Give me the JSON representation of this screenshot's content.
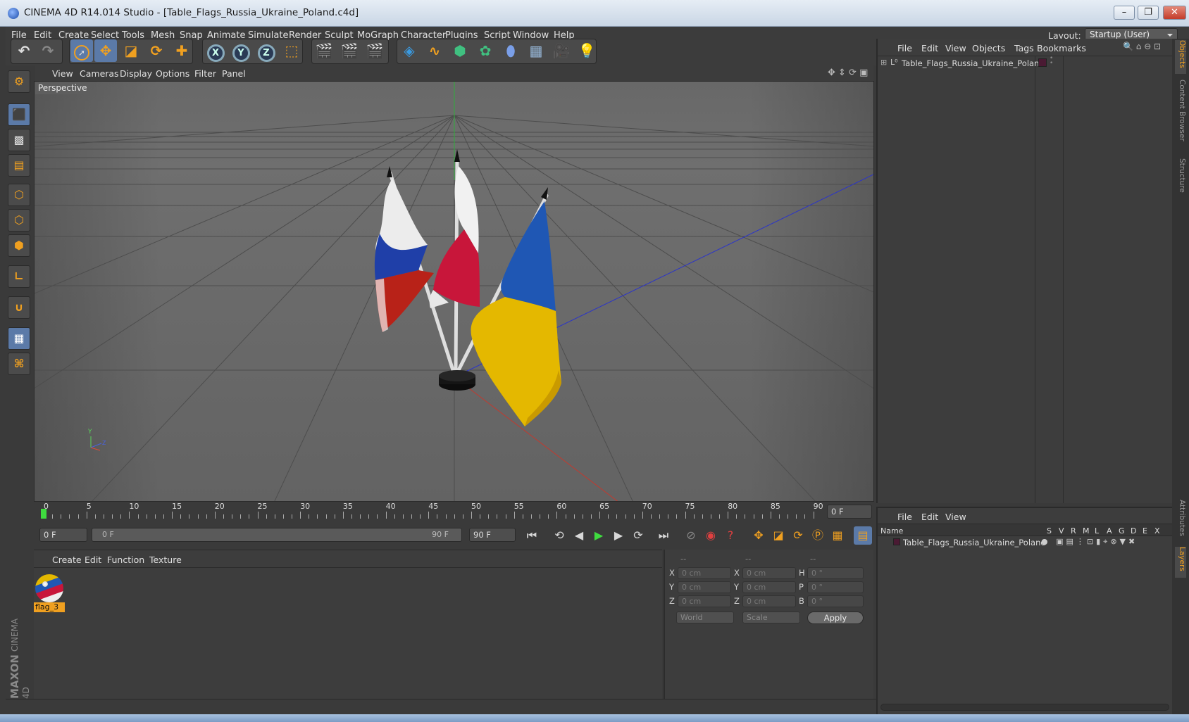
{
  "window": {
    "title": "CINEMA 4D R14.014 Studio - [Table_Flags_Russia_Ukraine_Poland.c4d]"
  },
  "menu": [
    "File",
    "Edit",
    "Create",
    "Select",
    "Tools",
    "Mesh",
    "Snap",
    "Animate",
    "Simulate",
    "Render",
    "Sculpt",
    "MoGraph",
    "Character",
    "Plugins",
    "Script",
    "Window",
    "Help"
  ],
  "layout": {
    "label": "Layout:",
    "value": "Startup (User)"
  },
  "viewport": {
    "menu": [
      "View",
      "Cameras",
      "Display",
      "Options",
      "Filter",
      "Panel"
    ],
    "label": "Perspective",
    "axis_labels": {
      "y": "Y",
      "z": "Z"
    }
  },
  "timeline": {
    "ticks": [
      "0",
      "5",
      "10",
      "15",
      "20",
      "25",
      "30",
      "35",
      "40",
      "45",
      "50",
      "55",
      "60",
      "65",
      "70",
      "75",
      "80",
      "85",
      "90"
    ],
    "current_frame": "0 F",
    "start_field": "0 F",
    "range_start": "0 F",
    "range_end": "90 F",
    "end_field": "90 F"
  },
  "material_manager": {
    "menu": [
      "Create",
      "Edit",
      "Function",
      "Texture"
    ],
    "materials": [
      {
        "name": "flag_3"
      }
    ]
  },
  "coordinates": {
    "headers": [
      "--",
      "--",
      "--"
    ],
    "rows": [
      {
        "l1": "X",
        "v1": "0 cm",
        "l2": "X",
        "v2": "0 cm",
        "l3": "H",
        "v3": "0 °"
      },
      {
        "l1": "Y",
        "v1": "0 cm",
        "l2": "Y",
        "v2": "0 cm",
        "l3": "P",
        "v3": "0 °"
      },
      {
        "l1": "Z",
        "v1": "0 cm",
        "l2": "Z",
        "v2": "0 cm",
        "l3": "B",
        "v3": "0 °"
      }
    ],
    "mode": "World",
    "transform": "Scale",
    "apply": "Apply"
  },
  "object_manager": {
    "menu": [
      "File",
      "Edit",
      "View",
      "Objects",
      "Tags",
      "Bookmarks"
    ],
    "objects": [
      {
        "name": "Table_Flags_Russia_Ukraine_Poland",
        "layer_color": "#4a1a33"
      }
    ]
  },
  "layer_manager": {
    "menu": [
      "File",
      "Edit",
      "View"
    ],
    "columns": {
      "name": "Name",
      "flags": [
        "S",
        "V",
        "R",
        "M",
        "L",
        "A",
        "G",
        "D",
        "E",
        "X"
      ]
    },
    "layers": [
      {
        "name": "Table_Flags_Russia_Ukraine_Poland"
      }
    ]
  },
  "side_tabs": [
    "Objects",
    "Content Browser",
    "Structure",
    "Attributes",
    "Layers"
  ],
  "branding": {
    "maxon": "MAXON",
    "cinema": "CINEMA 4D"
  },
  "colors": {
    "accent": "#f0a020",
    "russia_blue": "#1f3fa8",
    "russia_red": "#b82218",
    "poland_red": "#c8163a",
    "ukraine_blue": "#1f57b4",
    "ukraine_yellow": "#e4b800"
  }
}
